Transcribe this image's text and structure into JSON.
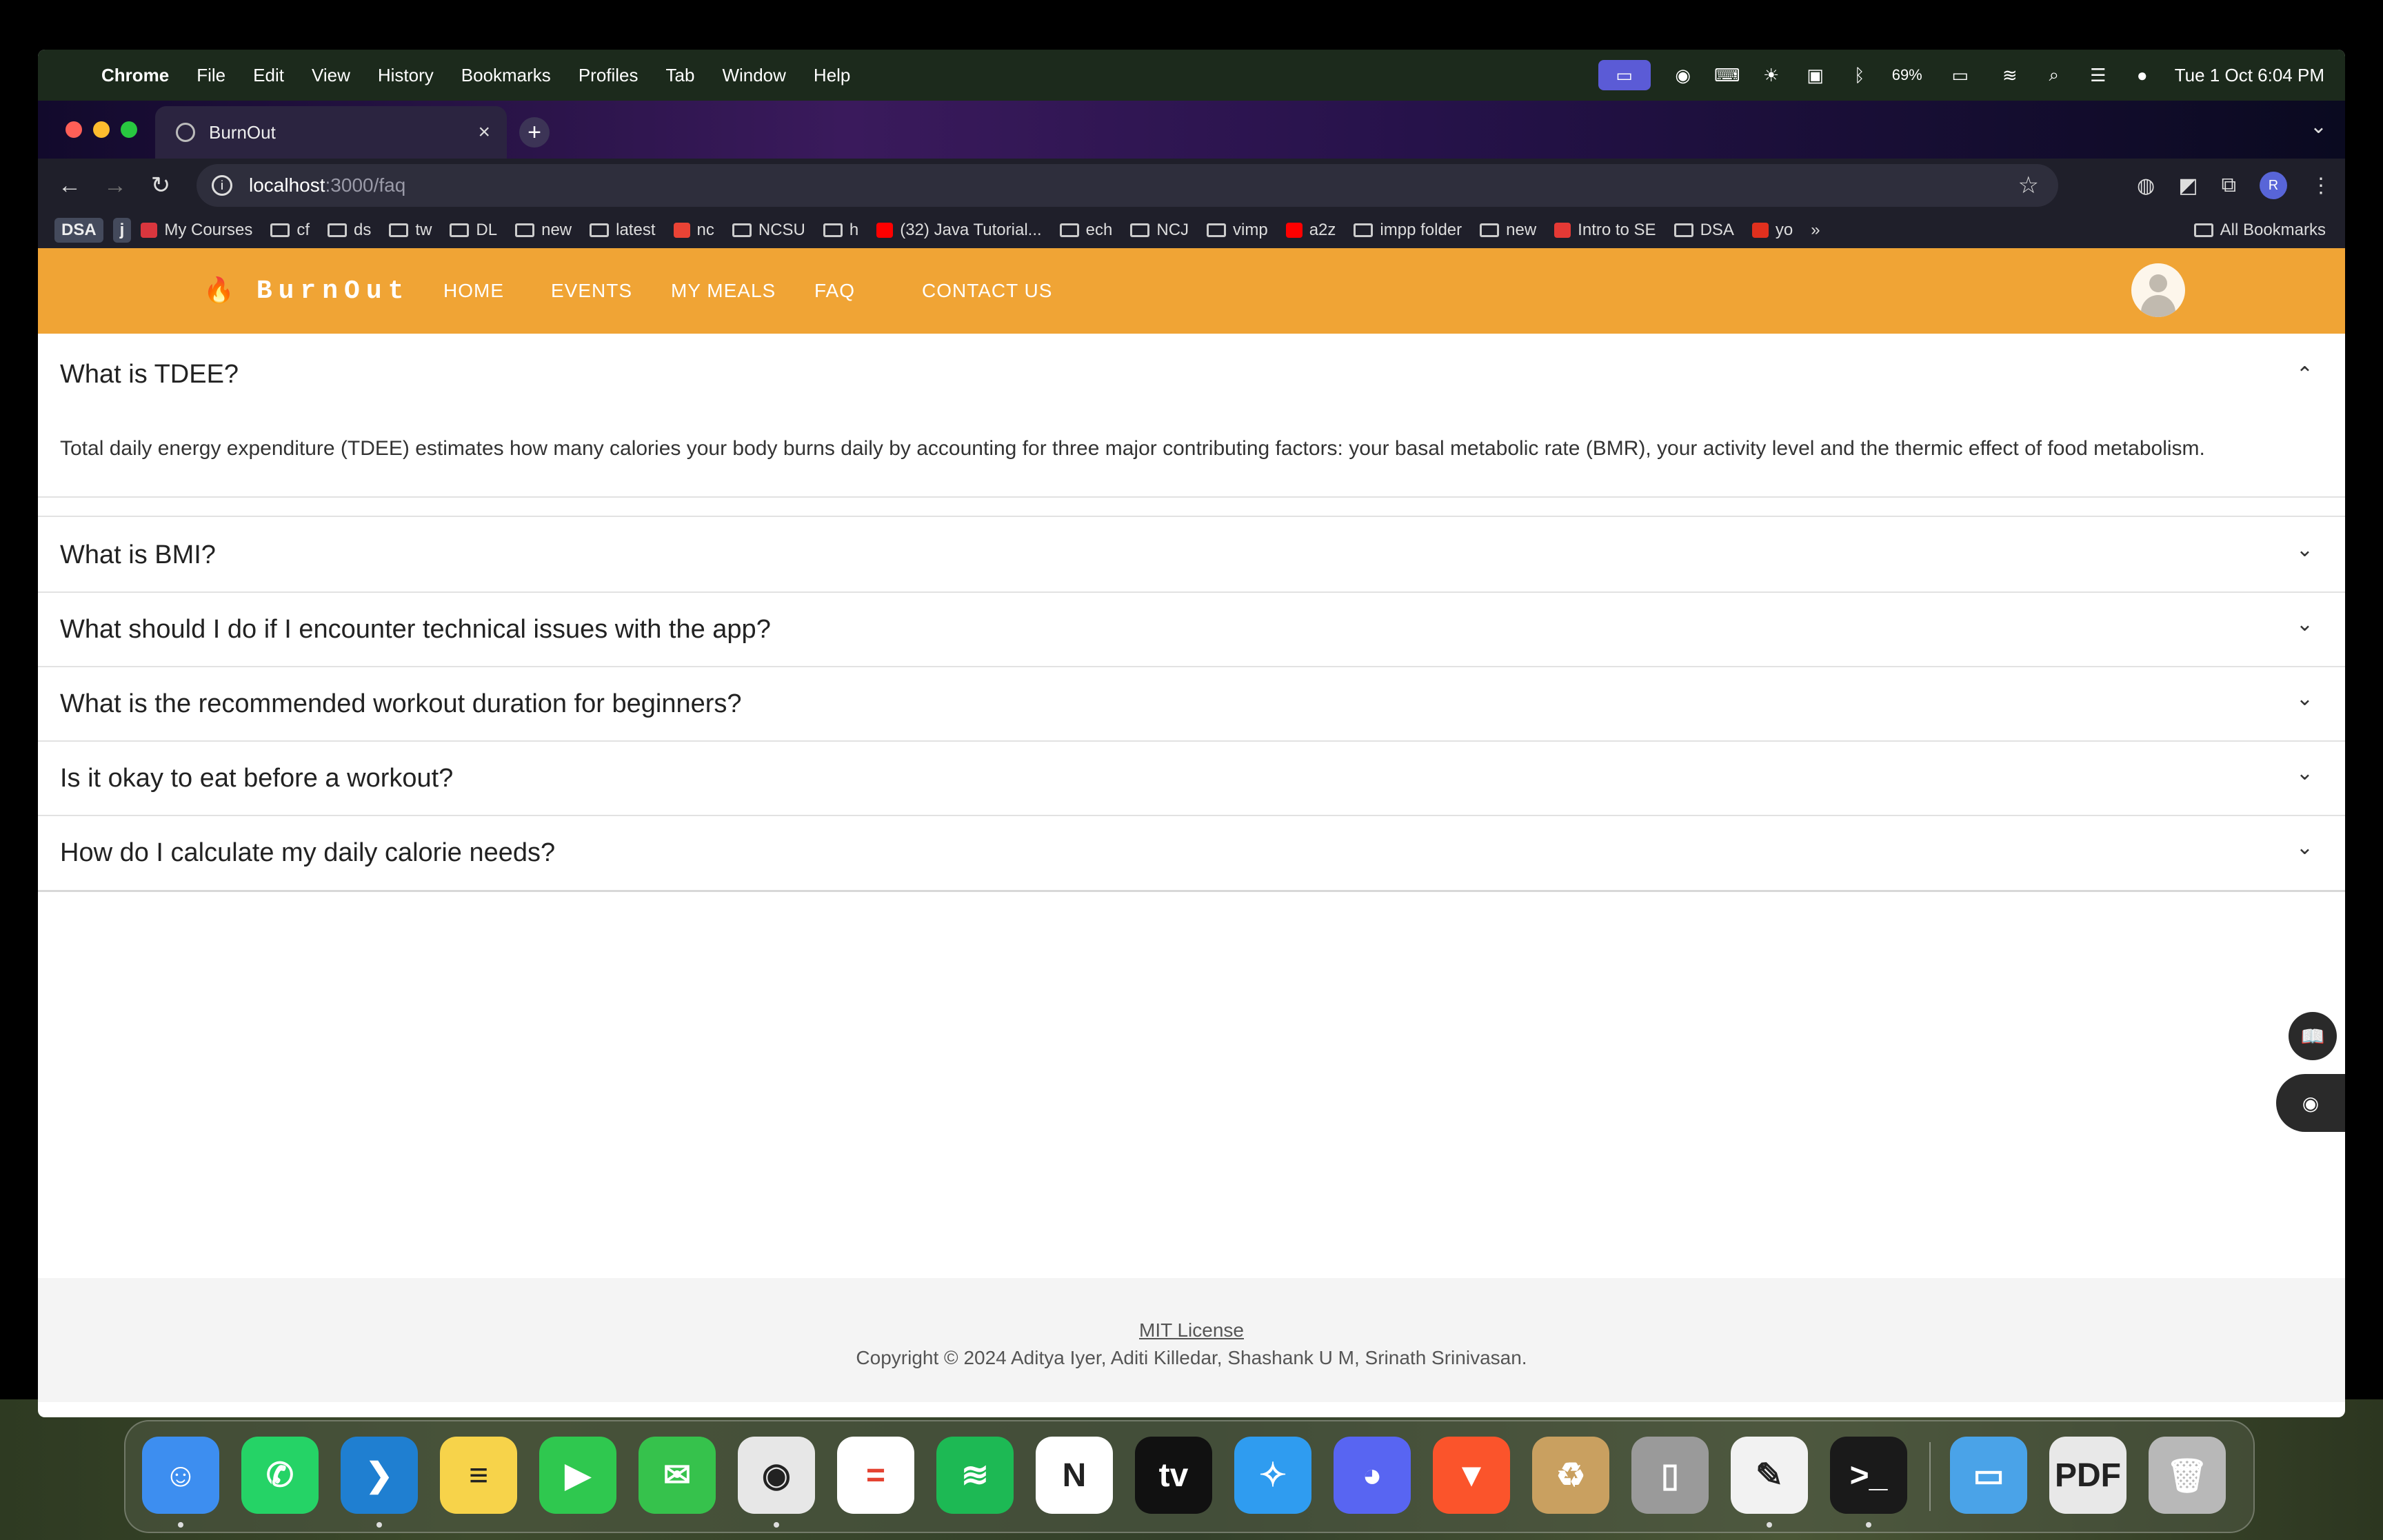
{
  "menubar": {
    "app": "Chrome",
    "items": [
      "File",
      "Edit",
      "View",
      "History",
      "Bookmarks",
      "Profiles",
      "Tab",
      "Window",
      "Help"
    ],
    "battery": "69%",
    "datetime": "Tue 1 Oct  6:04 PM"
  },
  "browser": {
    "tab_title": "BurnOut",
    "url_host": "localhost",
    "url_path": ":3000/faq",
    "profile_initial": "R",
    "bookmarks": [
      {
        "label": "DSA",
        "kind": "badge"
      },
      {
        "label": "j",
        "kind": "badge"
      },
      {
        "label": "My Courses",
        "kind": "fav",
        "color": "#d9363e"
      },
      {
        "label": "cf",
        "kind": "folder"
      },
      {
        "label": "ds",
        "kind": "folder"
      },
      {
        "label": "tw",
        "kind": "folder"
      },
      {
        "label": "DL",
        "kind": "folder"
      },
      {
        "label": "new",
        "kind": "folder"
      },
      {
        "label": "latest",
        "kind": "folder"
      },
      {
        "label": "nc",
        "kind": "fav",
        "color": "#ea4335"
      },
      {
        "label": "NCSU",
        "kind": "folder"
      },
      {
        "label": "h",
        "kind": "folder"
      },
      {
        "label": "(32) Java Tutorial...",
        "kind": "fav",
        "color": "#ff0000"
      },
      {
        "label": "ech",
        "kind": "folder"
      },
      {
        "label": "NCJ",
        "kind": "folder"
      },
      {
        "label": "vimp",
        "kind": "folder"
      },
      {
        "label": "a2z",
        "kind": "fav",
        "color": "#ff0000"
      },
      {
        "label": "impp folder",
        "kind": "folder"
      },
      {
        "label": "new",
        "kind": "folder"
      },
      {
        "label": "Intro to SE",
        "kind": "fav",
        "color": "#e53935"
      },
      {
        "label": "DSA",
        "kind": "folder"
      },
      {
        "label": "yo",
        "kind": "fav",
        "color": "#e0301e"
      }
    ],
    "overflow": "»",
    "all_bookmarks": "All Bookmarks"
  },
  "site": {
    "brand": "BurnOut",
    "nav": [
      "HOME",
      "EVENTS",
      "MY MEALS",
      "FAQ",
      "CONTACT US"
    ]
  },
  "faqs": [
    {
      "question": "What is TDEE?",
      "expanded": true,
      "answer": "Total daily energy expenditure (TDEE) estimates how many calories your body burns daily by accounting for three major contributing factors: your basal metabolic rate (BMR), your activity level and the thermic effect of food metabolism."
    },
    {
      "question": "What is BMI?",
      "expanded": false
    },
    {
      "question": "What should I do if I encounter technical issues with the app?",
      "expanded": false
    },
    {
      "question": "What is the recommended workout duration for beginners?",
      "expanded": false
    },
    {
      "question": "Is it okay to eat before a workout?",
      "expanded": false
    },
    {
      "question": "How do I calculate my daily calorie needs?",
      "expanded": false
    }
  ],
  "footer": {
    "license": "MIT License",
    "copyright": "Copyright © 2024 Aditya Iyer, Aditi Killedar, Shashank U M, Srinath Srinivasan."
  },
  "dock": [
    {
      "name": "finder",
      "color": "#3d8ef0",
      "glyph": "☺"
    },
    {
      "name": "whatsapp",
      "color": "#25d366",
      "glyph": "✆"
    },
    {
      "name": "vscode",
      "color": "#1f7fd1",
      "glyph": "❯"
    },
    {
      "name": "notes",
      "color": "#f7d34a",
      "glyph": "≡"
    },
    {
      "name": "facetime",
      "color": "#2fc84f",
      "glyph": "▶"
    },
    {
      "name": "messages",
      "color": "#36c24c",
      "glyph": "✉"
    },
    {
      "name": "chrome",
      "color": "#e7e7e7",
      "glyph": "◉"
    },
    {
      "name": "todoist",
      "color": "#ffffff",
      "glyph": "="
    },
    {
      "name": "spotify",
      "color": "#1db954",
      "glyph": "≋"
    },
    {
      "name": "notion",
      "color": "#ffffff",
      "glyph": "N"
    },
    {
      "name": "apple-tv",
      "color": "#111111",
      "glyph": "tv"
    },
    {
      "name": "safari",
      "color": "#2f9cf0",
      "glyph": "✧"
    },
    {
      "name": "discord",
      "color": "#5865f2",
      "glyph": "◕"
    },
    {
      "name": "brave",
      "color": "#fb542b",
      "glyph": "▼"
    },
    {
      "name": "recycle-app",
      "color": "#c9a060",
      "glyph": "♻"
    },
    {
      "name": "iphone-mirroring",
      "color": "#9a9a9a",
      "glyph": "▯"
    },
    {
      "name": "textedit",
      "color": "#f2f2f2",
      "glyph": "✎"
    },
    {
      "name": "terminal",
      "color": "#1a1a1a",
      "glyph": ">_"
    },
    {
      "name": "files-folder",
      "color": "#4aa3e8",
      "glyph": "▭"
    },
    {
      "name": "pdf-document",
      "color": "#e8e8e8",
      "glyph": "PDF"
    },
    {
      "name": "trash",
      "color": "#b8b8b8",
      "glyph": "🗑"
    }
  ]
}
